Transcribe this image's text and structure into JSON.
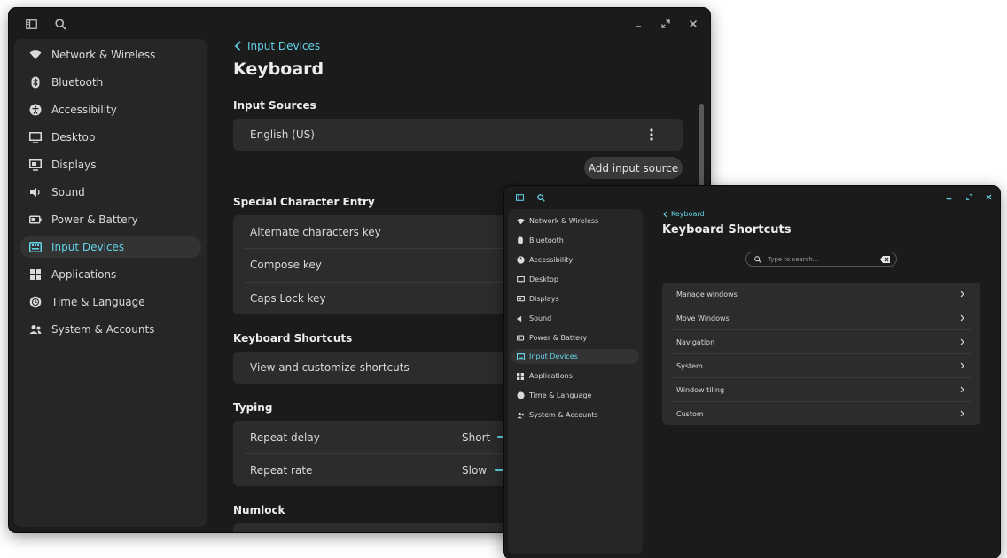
{
  "accent": "#63d3e8",
  "sidebar": {
    "items": [
      {
        "label": "Network & Wireless",
        "icon": "wifi-icon"
      },
      {
        "label": "Bluetooth",
        "icon": "bluetooth-icon"
      },
      {
        "label": "Accessibility",
        "icon": "accessibility-icon"
      },
      {
        "label": "Desktop",
        "icon": "desktop-icon"
      },
      {
        "label": "Displays",
        "icon": "displays-icon"
      },
      {
        "label": "Sound",
        "icon": "speaker-icon"
      },
      {
        "label": "Power & Battery",
        "icon": "battery-icon"
      },
      {
        "label": "Input Devices",
        "icon": "keyboard-icon"
      },
      {
        "label": "Applications",
        "icon": "grid-icon"
      },
      {
        "label": "Time & Language",
        "icon": "globe-icon"
      },
      {
        "label": "System & Accounts",
        "icon": "users-icon"
      }
    ],
    "active": "Input Devices"
  },
  "keyboard_page": {
    "breadcrumb": "Input Devices",
    "title": "Keyboard",
    "input_sources": {
      "heading": "Input Sources",
      "source": "English (US)",
      "add_button": "Add input source"
    },
    "special_chars": {
      "heading": "Special Character Entry",
      "rows": [
        "Alternate characters key",
        "Compose key",
        "Caps Lock key"
      ]
    },
    "shortcuts": {
      "heading": "Keyboard Shortcuts",
      "row": "View and customize shortcuts"
    },
    "typing": {
      "heading": "Typing",
      "repeat_delay": {
        "label": "Repeat delay",
        "min_label": "Short"
      },
      "repeat_rate": {
        "label": "Repeat rate",
        "min_label": "Slow"
      }
    },
    "numlock": {
      "heading": "Numlock"
    }
  },
  "shortcuts_page": {
    "breadcrumb": "Keyboard",
    "title": "Keyboard Shortcuts",
    "search_placeholder": "Type to search...",
    "rows": [
      "Manage windows",
      "Move Windows",
      "Navigation",
      "System",
      "Window tiling",
      "Custom"
    ]
  }
}
